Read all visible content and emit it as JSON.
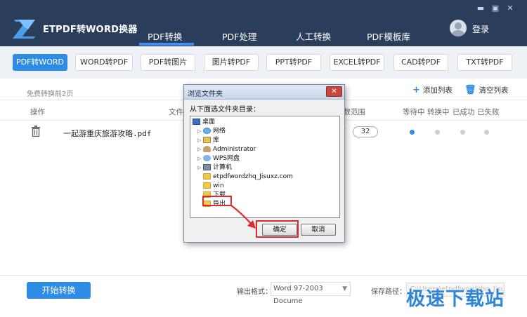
{
  "app": {
    "title": "ETPDF转WORD换器",
    "login_label": "登录",
    "window_controls": [
      "minimize-icon",
      "maximize-icon",
      "close-icon"
    ]
  },
  "nav": {
    "tabs": [
      "PDF转换",
      "PDF处理",
      "人工转换",
      "PDF模板库"
    ],
    "active": "PDF转换"
  },
  "subtabs": {
    "items": [
      "PDF转WORD",
      "WORD转PDF",
      "PDF转图片",
      "图片转PDF",
      "PPT转PDF",
      "EXCEL转PDF",
      "CAD转PDF",
      "TXT转PDF"
    ],
    "active": "PDF转WORD"
  },
  "toolbar": {
    "free_note": "免费转换前2页",
    "add_list": "添加列表",
    "clear_list": "清空列表"
  },
  "table": {
    "headers": {
      "action": "操作",
      "filename": "文件名",
      "page_range": "页数范围",
      "waiting": "等待中",
      "converting": "转换中",
      "success": "已成功",
      "failed": "已失败"
    },
    "rows": [
      {
        "filename": "一起游重庆旅游攻略.pdf",
        "range_selector": "▽",
        "pages": "32",
        "status": "waiting"
      }
    ]
  },
  "footer": {
    "start_button": "开始转换",
    "format_label": "输出格式：",
    "format_value": "Word 97-2003 Docume",
    "save_label": "保存路径：",
    "save_path": "C:\\Users\\etpdfwordzhq_Jisuxz.com"
  },
  "watermark": "极速下载站",
  "dialog": {
    "title": "浏览文件夹",
    "close": "✕",
    "prompt": "从下面选文件夹目录：",
    "tree": [
      {
        "label": "桌面",
        "icon": "desktop-icon",
        "expander": "",
        "level": 0
      },
      {
        "label": "网络",
        "icon": "network-icon",
        "expander": "▷",
        "level": 1
      },
      {
        "label": "库",
        "icon": "library-icon",
        "expander": "▷",
        "level": 1
      },
      {
        "label": "Administrator",
        "icon": "user-folder-icon",
        "expander": "▷",
        "level": 1
      },
      {
        "label": "WPS网盘",
        "icon": "cloud-icon",
        "expander": "▷",
        "level": 1
      },
      {
        "label": "计算机",
        "icon": "computer-icon",
        "expander": "▷",
        "level": 1
      },
      {
        "label": "etpdfwordzhq_Jisuxz.com",
        "icon": "folder-icon",
        "expander": "",
        "level": 1
      },
      {
        "label": "win",
        "icon": "folder-icon",
        "expander": "",
        "level": 1
      },
      {
        "label": "下载",
        "icon": "folder-icon",
        "expander": "",
        "level": 1
      },
      {
        "label": "导出",
        "icon": "folder-icon",
        "expander": "",
        "level": 1,
        "selected": true
      }
    ],
    "ok": "确定",
    "cancel": "取消"
  },
  "colors": {
    "header_bg": "#2a3e5c",
    "accent": "#2f8ce5",
    "highlight": "#e0282e"
  }
}
